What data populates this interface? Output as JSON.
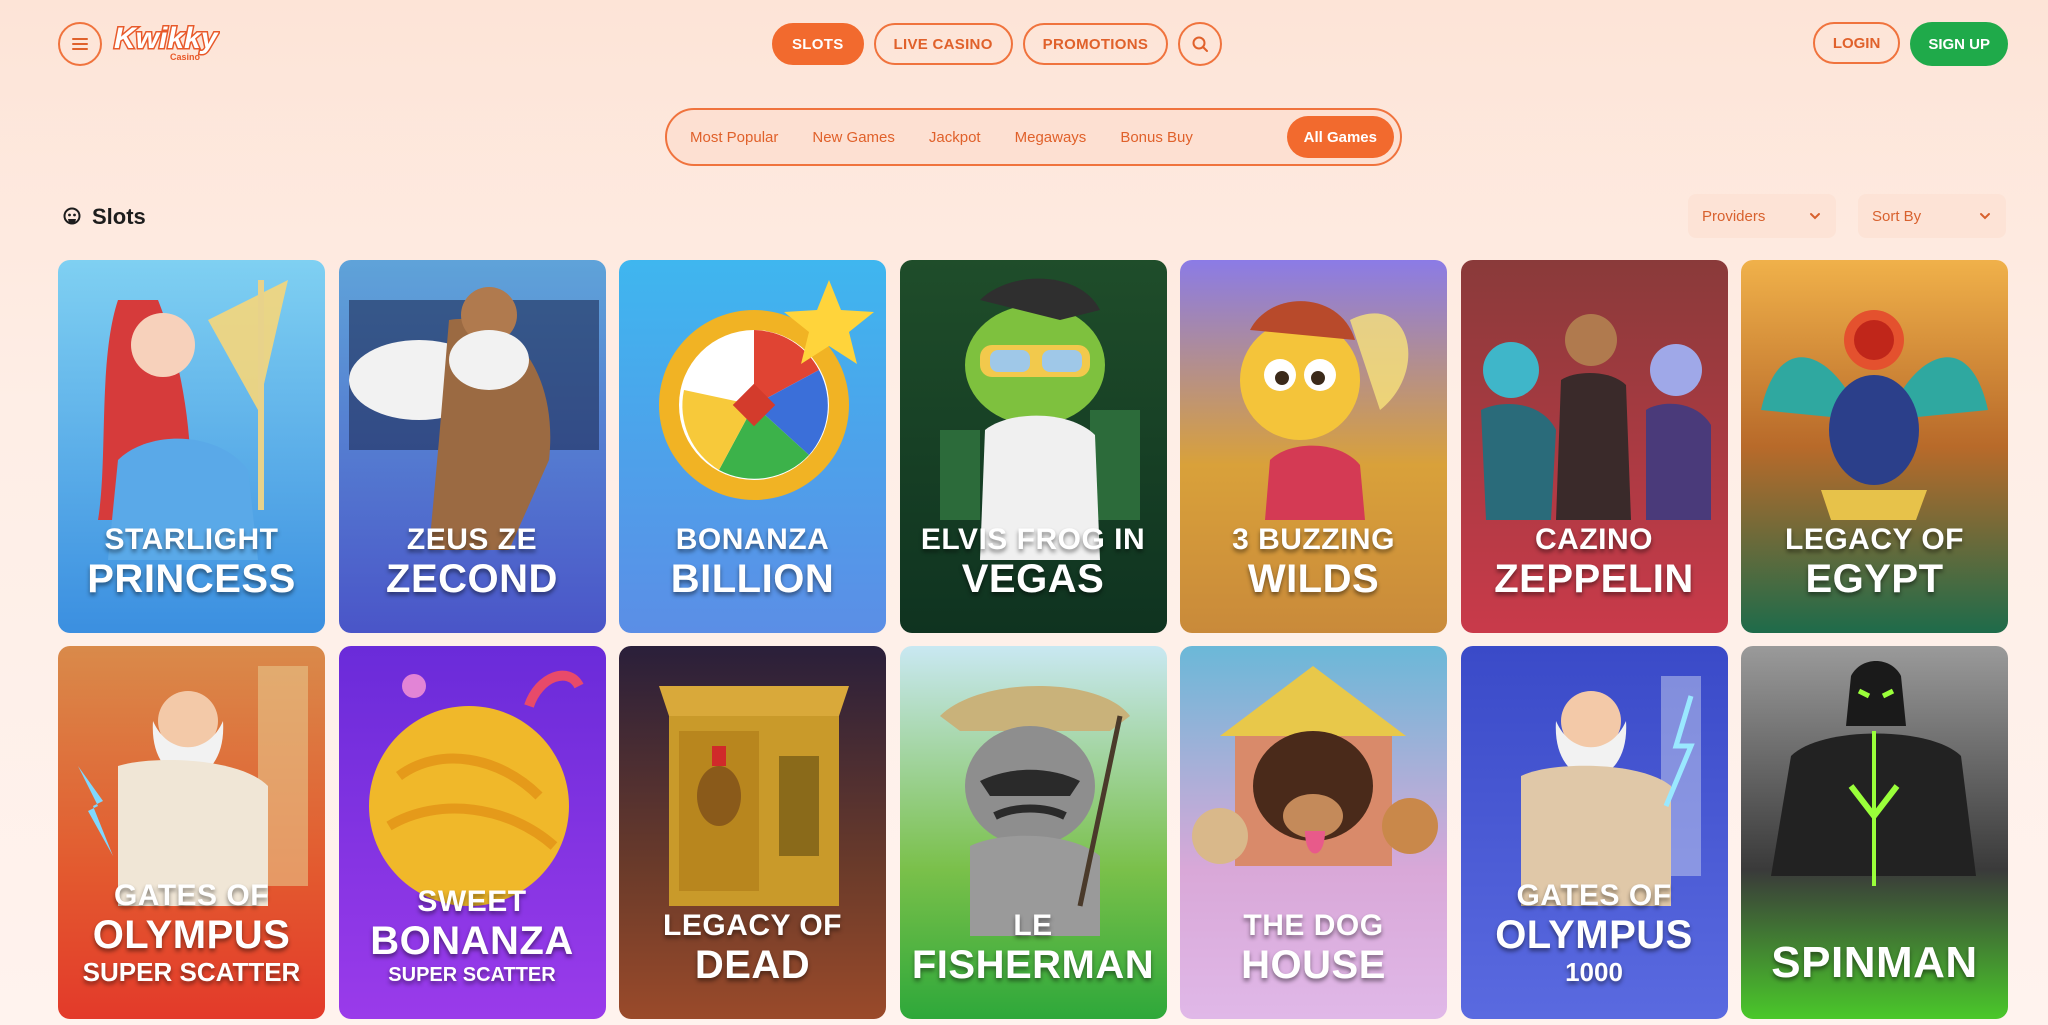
{
  "header": {
    "logo_text": "Kwikky",
    "logo_subtext": "Casino",
    "nav": [
      "SLOTS",
      "LIVE CASINO",
      "PROMOTIONS"
    ],
    "login": "LOGIN",
    "signup": "SIGN UP"
  },
  "categories": [
    "Most Popular",
    "New Games",
    "Jackpot",
    "Megaways",
    "Bonus Buy",
    "All Games"
  ],
  "section": {
    "title": "Slots",
    "providers": "Providers",
    "sort": "Sort By"
  },
  "games": [
    {
      "l1": "STARLIGHT",
      "l2": "PRINCESS",
      "l3": ""
    },
    {
      "l1": "ZEUS ZE",
      "l2": "ZECOND",
      "l3": ""
    },
    {
      "l1": "BONANZA",
      "l2": "BILLION",
      "l3": ""
    },
    {
      "l1": "ELVIS FROG IN",
      "l2": "VEGAS",
      "l3": ""
    },
    {
      "l1": "3 BUZZING",
      "l2": "WILDS",
      "l3": ""
    },
    {
      "l1": "CAZINO",
      "l2": "ZEPPELIN",
      "l3": ""
    },
    {
      "l1": "LEGACY OF",
      "l2": "EGYPT",
      "l3": ""
    },
    {
      "l1": "GATES OF",
      "l2": "OLYMPUS",
      "l3": "SUPER SCATTER"
    },
    {
      "l1": "SWEET",
      "l2": "BONANZA",
      "l3": "SUPER SCATTER"
    },
    {
      "l1": "LEGACY OF",
      "l2": "DEAD",
      "l3": ""
    },
    {
      "l1": "LE",
      "l2": "FISHERMAN",
      "l3": ""
    },
    {
      "l1": "THE DOG",
      "l2": "HOUSE",
      "l3": ""
    },
    {
      "l1": "GATES OF",
      "l2": "OLYMPUS",
      "l3": "1000"
    },
    {
      "l1": "",
      "l2": "SPINMAN",
      "l3": ""
    }
  ],
  "icons": {
    "menu": "menu-icon",
    "search": "search-icon",
    "section": "slots-icon",
    "chevron": "chevron-down-icon"
  },
  "colors": {
    "accent": "#f26a2e",
    "signup": "#1faa4a"
  }
}
